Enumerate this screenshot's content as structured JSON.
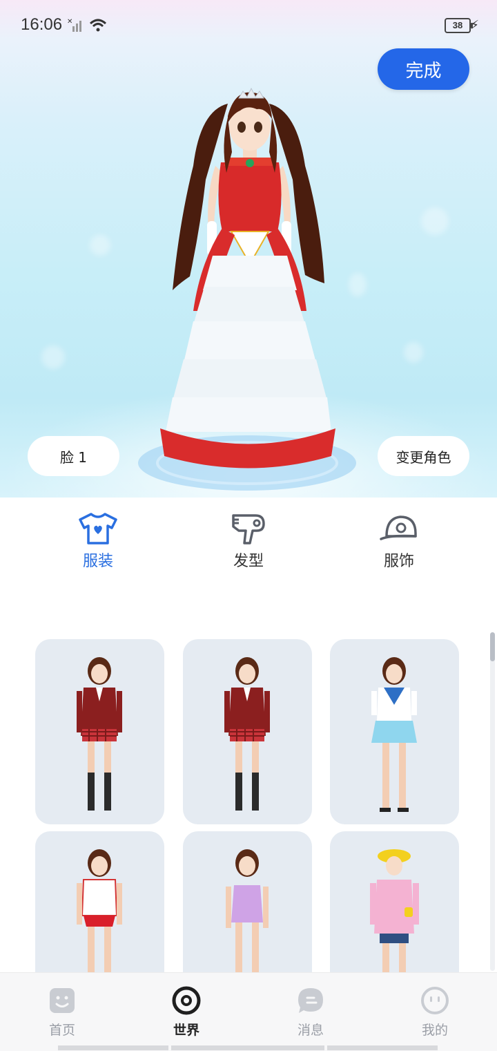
{
  "status_bar": {
    "time": "16:06",
    "battery": "38"
  },
  "hero": {
    "done_button": "完成",
    "face_button": "脸 1",
    "change_character_button": "变更角色"
  },
  "category_tabs": [
    {
      "label": "服装",
      "icon": "tshirt-icon",
      "active": true
    },
    {
      "label": "发型",
      "icon": "hair-dryer-icon",
      "active": false
    },
    {
      "label": "服饰",
      "icon": "cap-icon",
      "active": false
    }
  ],
  "outfits": [
    {
      "name": "red-blazer-uniform-black-socks"
    },
    {
      "name": "red-blazer-uniform-black-socks-2"
    },
    {
      "name": "sailor-uniform-blue-skirt"
    },
    {
      "name": "gym-uniform-red-shorts"
    },
    {
      "name": "purple-swimsuit"
    },
    {
      "name": "pink-kindergarten-uniform-yellow-hat"
    }
  ],
  "bottom_nav": [
    {
      "label": "首页",
      "icon": "home-smile-icon",
      "active": false
    },
    {
      "label": "世界",
      "icon": "world-ring-icon",
      "active": true
    },
    {
      "label": "消息",
      "icon": "message-bubble-icon",
      "active": false
    },
    {
      "label": "我的",
      "icon": "profile-face-icon",
      "active": false
    }
  ],
  "colors": {
    "accent": "#2467e8",
    "active_tab": "#2a6fe0",
    "card_bg": "#e5ebf2"
  }
}
